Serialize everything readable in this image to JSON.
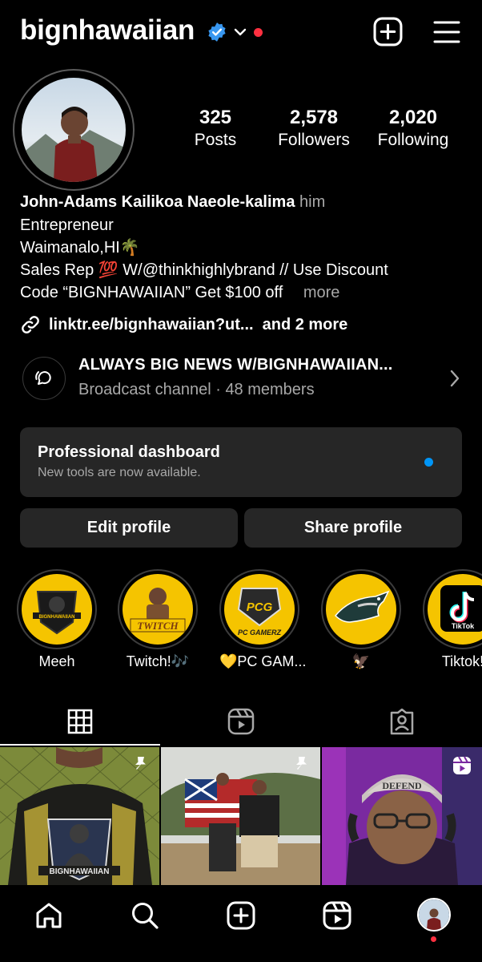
{
  "header": {
    "username": "bignhawaiian",
    "icons": [
      "verified-badge-icon",
      "chevron-down-icon",
      "notification-dot",
      "create-icon",
      "menu-icon"
    ]
  },
  "stats": [
    {
      "value": "325",
      "label": "Posts"
    },
    {
      "value": "2,578",
      "label": "Followers"
    },
    {
      "value": "2,020",
      "label": "Following"
    }
  ],
  "bio": {
    "full_name": "John-Adams Kailikoa Naeole-kalima",
    "pronouns": "him",
    "category": "Entrepreneur",
    "location": "Waimanalo,HI🌴",
    "line1": "Sales Rep 💯  W/@thinkhighlybrand // Use Discount",
    "line2": "Code “BIGNHAWAIIAN” Get $100 off",
    "more": "more",
    "link": "linktr.ee/bignhawaiian?ut...",
    "link_more": "and 2 more"
  },
  "broadcast": {
    "title": "ALWAYS BIG NEWS W/BIGNHAWAIIAN...",
    "subtitle": "Broadcast channel · 48 members"
  },
  "pro_dashboard": {
    "title": "Professional dashboard",
    "subtitle": "New tools are now available."
  },
  "buttons": {
    "edit": "Edit profile",
    "share": "Share profile"
  },
  "highlights": [
    {
      "label": "Meeh",
      "art": "BIGNHAWAIIAN"
    },
    {
      "label": "Twitch!🎶",
      "art": "TWITCH"
    },
    {
      "label": "💛PC GAM...",
      "art": "PC GAMERZ"
    },
    {
      "label": "🦅",
      "art": ""
    },
    {
      "label": "Tiktok!",
      "art": "TikTok"
    }
  ],
  "tabs": [
    "grid-icon",
    "reels-icon",
    "tagged-icon"
  ],
  "grid": [
    {
      "badge": "pin-icon",
      "caption": "BIGNHAWAIIAN"
    },
    {
      "badge": "pin-icon",
      "caption": ""
    },
    {
      "badge": "reels-icon",
      "caption": "DEFEND"
    }
  ],
  "nav": [
    "home-icon",
    "search-icon",
    "create-icon",
    "reels-icon",
    "profile-avatar"
  ],
  "colors": {
    "background": "#000000",
    "card": "#262626",
    "muted": "#a8a8a8",
    "verified": "#3897f0",
    "notification": "#ff3040",
    "accent": "#0095f6",
    "highlight_yellow": "#f5c400"
  }
}
